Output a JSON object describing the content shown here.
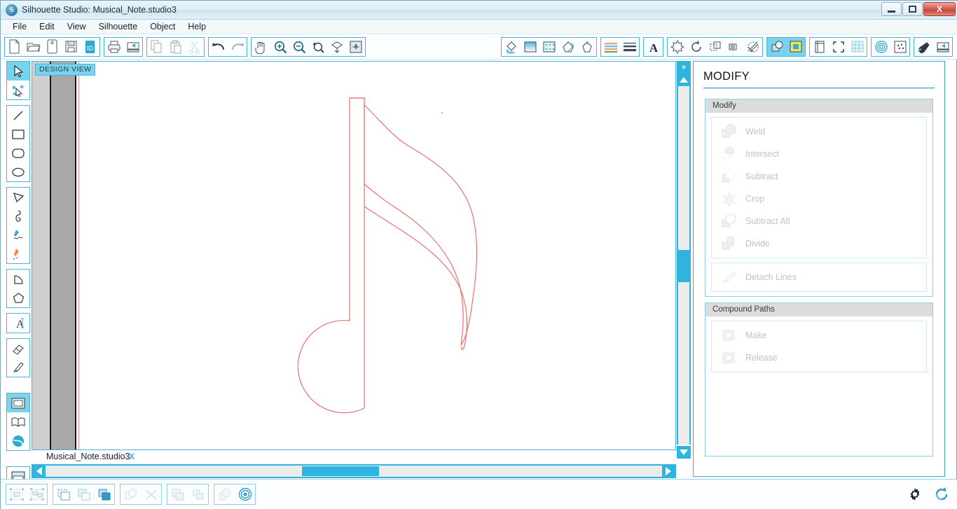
{
  "window": {
    "title": "Silhouette Studio: Musical_Note.studio3",
    "app_icon": "silhouette-logo-icon",
    "minimize_label": "–",
    "maximize_label": "□",
    "close_label": "X"
  },
  "menubar": {
    "items": [
      {
        "label": "File"
      },
      {
        "label": "Edit"
      },
      {
        "label": "View"
      },
      {
        "label": "Silhouette"
      },
      {
        "label": "Object"
      },
      {
        "label": "Help"
      }
    ]
  },
  "toolbar": {
    "groups": [
      {
        "name": "file-group",
        "buttons": [
          {
            "icon": "new-document-icon",
            "selected": false
          },
          {
            "icon": "open-folder-icon",
            "selected": false
          },
          {
            "icon": "save-as-icon",
            "selected": false
          },
          {
            "icon": "save-floppy-icon",
            "selected": false
          },
          {
            "icon": "save-library-icon",
            "selected": false
          }
        ]
      },
      {
        "name": "print-group",
        "buttons": [
          {
            "icon": "print-icon",
            "selected": false
          },
          {
            "icon": "send-to-silhouette-icon",
            "selected": false
          }
        ]
      },
      {
        "name": "clipboard-group",
        "buttons": [
          {
            "icon": "copy-icon",
            "selected": false
          },
          {
            "icon": "paste-icon",
            "selected": false
          },
          {
            "icon": "cut-scissors-icon",
            "selected": false
          }
        ]
      },
      {
        "name": "history-group",
        "buttons": [
          {
            "icon": "undo-icon",
            "selected": false
          },
          {
            "icon": "redo-icon",
            "selected": false
          }
        ]
      },
      {
        "name": "view-group",
        "buttons": [
          {
            "icon": "pan-hand-icon",
            "selected": false
          },
          {
            "icon": "zoom-in-icon",
            "selected": false
          },
          {
            "icon": "zoom-out-icon",
            "selected": false
          },
          {
            "icon": "zoom-selection-icon",
            "selected": false
          },
          {
            "icon": "zoom-fit-page-icon",
            "selected": false
          },
          {
            "icon": "zoom-all-icon",
            "selected": false
          }
        ]
      },
      {
        "name": "fill-group",
        "buttons": [
          {
            "icon": "fill-color-icon",
            "selected": false
          },
          {
            "icon": "fill-gradient-icon",
            "selected": false
          },
          {
            "icon": "fill-pattern-icon",
            "selected": false
          },
          {
            "icon": "sketch-pen-icon",
            "selected": false
          },
          {
            "icon": "offset-shape-icon",
            "selected": false
          }
        ]
      },
      {
        "name": "line-group",
        "buttons": [
          {
            "icon": "line-color-icon",
            "selected": false
          },
          {
            "icon": "line-style-icon",
            "selected": false
          }
        ]
      },
      {
        "name": "text-group",
        "buttons": [
          {
            "icon": "text-style-icon",
            "selected": false
          }
        ]
      },
      {
        "name": "transform-group",
        "buttons": [
          {
            "icon": "move-transform-icon",
            "selected": false
          },
          {
            "icon": "rotate-icon",
            "selected": false
          },
          {
            "icon": "scale-icon",
            "selected": false
          },
          {
            "icon": "mirror-icon",
            "selected": false
          },
          {
            "icon": "modify-shapes-icon",
            "selected": false
          }
        ]
      },
      {
        "name": "panel-group",
        "buttons": [
          {
            "icon": "modify-panel-icon",
            "selected": true
          },
          {
            "icon": "align-panel-icon",
            "selected": true
          }
        ]
      },
      {
        "name": "page-group",
        "buttons": [
          {
            "icon": "page-setup-icon",
            "selected": false
          },
          {
            "icon": "registration-marks-icon",
            "selected": false
          },
          {
            "icon": "grid-icon",
            "selected": false
          }
        ]
      },
      {
        "name": "trace-group",
        "buttons": [
          {
            "icon": "spiral-trace-icon",
            "selected": false
          },
          {
            "icon": "stipple-icon",
            "selected": false
          }
        ]
      },
      {
        "name": "cut-group",
        "buttons": [
          {
            "icon": "cut-settings-pen-icon",
            "selected": false
          },
          {
            "icon": "send-cut-icon",
            "selected": false
          }
        ]
      }
    ]
  },
  "tool_palette": {
    "groups": [
      {
        "tools": [
          {
            "icon": "select-arrow-icon",
            "selected": true
          },
          {
            "icon": "edit-points-icon",
            "selected": false
          }
        ]
      },
      {
        "tools": [
          {
            "icon": "line-tool-icon",
            "selected": false
          },
          {
            "icon": "rectangle-tool-icon",
            "selected": false
          },
          {
            "icon": "rounded-rectangle-tool-icon",
            "selected": false
          },
          {
            "icon": "ellipse-tool-icon",
            "selected": false
          }
        ]
      },
      {
        "tools": [
          {
            "icon": "polygon-tool-icon",
            "selected": false
          },
          {
            "icon": "curve-tool-icon",
            "selected": false
          },
          {
            "icon": "freehand-tool-icon",
            "selected": false
          },
          {
            "icon": "smooth-freehand-tool-icon",
            "selected": false
          }
        ]
      },
      {
        "tools": [
          {
            "icon": "arc-tool-icon",
            "selected": false
          },
          {
            "icon": "regular-polygon-tool-icon",
            "selected": false
          }
        ]
      },
      {
        "tools": [
          {
            "icon": "text-tool-icon",
            "selected": false
          }
        ]
      },
      {
        "tools": [
          {
            "icon": "eraser-tool-icon",
            "selected": false
          },
          {
            "icon": "knife-tool-icon",
            "selected": false
          }
        ]
      },
      {
        "tools": [
          {
            "icon": "design-view-icon",
            "selected": true
          },
          {
            "icon": "library-book-icon",
            "selected": false
          },
          {
            "icon": "store-globe-icon",
            "selected": false
          }
        ]
      },
      {
        "tools": [
          {
            "icon": "send-panel-icon",
            "selected": false
          }
        ]
      },
      {
        "tools": [
          {
            "icon": "play-preview-icon",
            "selected": false
          }
        ]
      }
    ]
  },
  "canvas": {
    "view_label": "DESIGN VIEW",
    "artwork_name": "musical-note-sixteenth",
    "cut_line_color": "#ee6f6f",
    "mat_edge_color": "#ef8d8d",
    "background": "#ffffff"
  },
  "scrollbars": {
    "expand_label": "»",
    "vertical_up": "up-arrow-icon",
    "vertical_down": "down-arrow-icon",
    "horizontal_left": "left-arrow-icon",
    "horizontal_right": "right-arrow-icon",
    "accent_color": "#2fb4dd"
  },
  "document_tab": {
    "label": "Musical_Note.studio3",
    "close_label": "X"
  },
  "right_panel": {
    "title": "MODIFY",
    "sections": [
      {
        "header": "Modify",
        "groups": [
          {
            "rows": [
              {
                "label": "Weld",
                "icon": "weld-icon",
                "enabled": false
              },
              {
                "label": "Intersect",
                "icon": "intersect-icon",
                "enabled": false
              },
              {
                "label": "Subtract",
                "icon": "subtract-icon",
                "enabled": false
              },
              {
                "label": "Crop",
                "icon": "crop-icon",
                "enabled": false
              },
              {
                "label": "Subtract All",
                "icon": "subtract-all-icon",
                "enabled": false
              },
              {
                "label": "Divide",
                "icon": "divide-icon",
                "enabled": false
              }
            ]
          },
          {
            "rows": [
              {
                "label": "Detach Lines",
                "icon": "detach-lines-icon",
                "enabled": false
              }
            ]
          }
        ]
      },
      {
        "header": "Compound Paths",
        "groups": [
          {
            "rows": [
              {
                "label": "Make",
                "icon": "make-compound-path-icon",
                "enabled": false
              },
              {
                "label": "Release",
                "icon": "release-compound-path-icon",
                "enabled": false
              }
            ]
          }
        ]
      }
    ]
  },
  "status_bar": {
    "groups": [
      {
        "buttons": [
          {
            "icon": "group-objects-icon"
          },
          {
            "icon": "ungroup-objects-icon"
          }
        ]
      },
      {
        "buttons": [
          {
            "icon": "bring-to-front-icon"
          },
          {
            "icon": "bring-forward-icon"
          },
          {
            "icon": "send-backward-icon"
          }
        ]
      },
      {
        "buttons": [
          {
            "icon": "weld-status-icon"
          },
          {
            "icon": "release-compound-status-icon"
          }
        ]
      },
      {
        "buttons": [
          {
            "icon": "duplicate-icon"
          },
          {
            "icon": "replicate-icon"
          }
        ]
      },
      {
        "buttons": [
          {
            "icon": "fill-shape-icon"
          },
          {
            "icon": "offset-rings-icon"
          }
        ]
      }
    ],
    "right_buttons": [
      {
        "icon": "gear-settings-icon"
      },
      {
        "icon": "sync-refresh-icon"
      }
    ]
  }
}
